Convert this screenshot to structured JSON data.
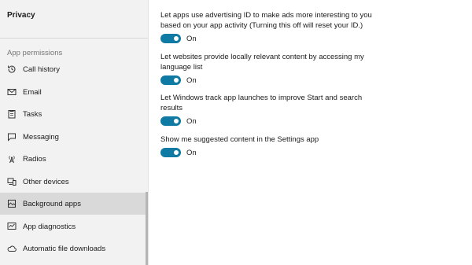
{
  "sidebar": {
    "title": "Privacy",
    "section_header": "App permissions",
    "items": [
      {
        "label": "Call history",
        "icon": "call-history-icon"
      },
      {
        "label": "Email",
        "icon": "mail-icon"
      },
      {
        "label": "Tasks",
        "icon": "tasks-icon"
      },
      {
        "label": "Messaging",
        "icon": "messaging-icon"
      },
      {
        "label": "Radios",
        "icon": "radio-tower-icon"
      },
      {
        "label": "Other devices",
        "icon": "devices-icon"
      },
      {
        "label": "Background apps",
        "icon": "background-apps-icon",
        "selected": true
      },
      {
        "label": "App diagnostics",
        "icon": "diagnostics-icon"
      },
      {
        "label": "Automatic file downloads",
        "icon": "cloud-icon"
      }
    ]
  },
  "options": [
    {
      "description": "Let apps use advertising ID to make ads more interesting to you based on your app activity (Turning this off will reset your ID.)",
      "state": "On"
    },
    {
      "description": "Let websites provide locally relevant content by accessing my language list",
      "state": "On"
    },
    {
      "description": "Let Windows track app launches to improve Start and search results",
      "state": "On"
    },
    {
      "description": "Show me suggested content in the Settings app",
      "state": "On"
    }
  ],
  "colors": {
    "accent": "#0f7aa3",
    "sidebar_bg": "#f2f2f2",
    "selected_bg": "#d9d9d9"
  }
}
